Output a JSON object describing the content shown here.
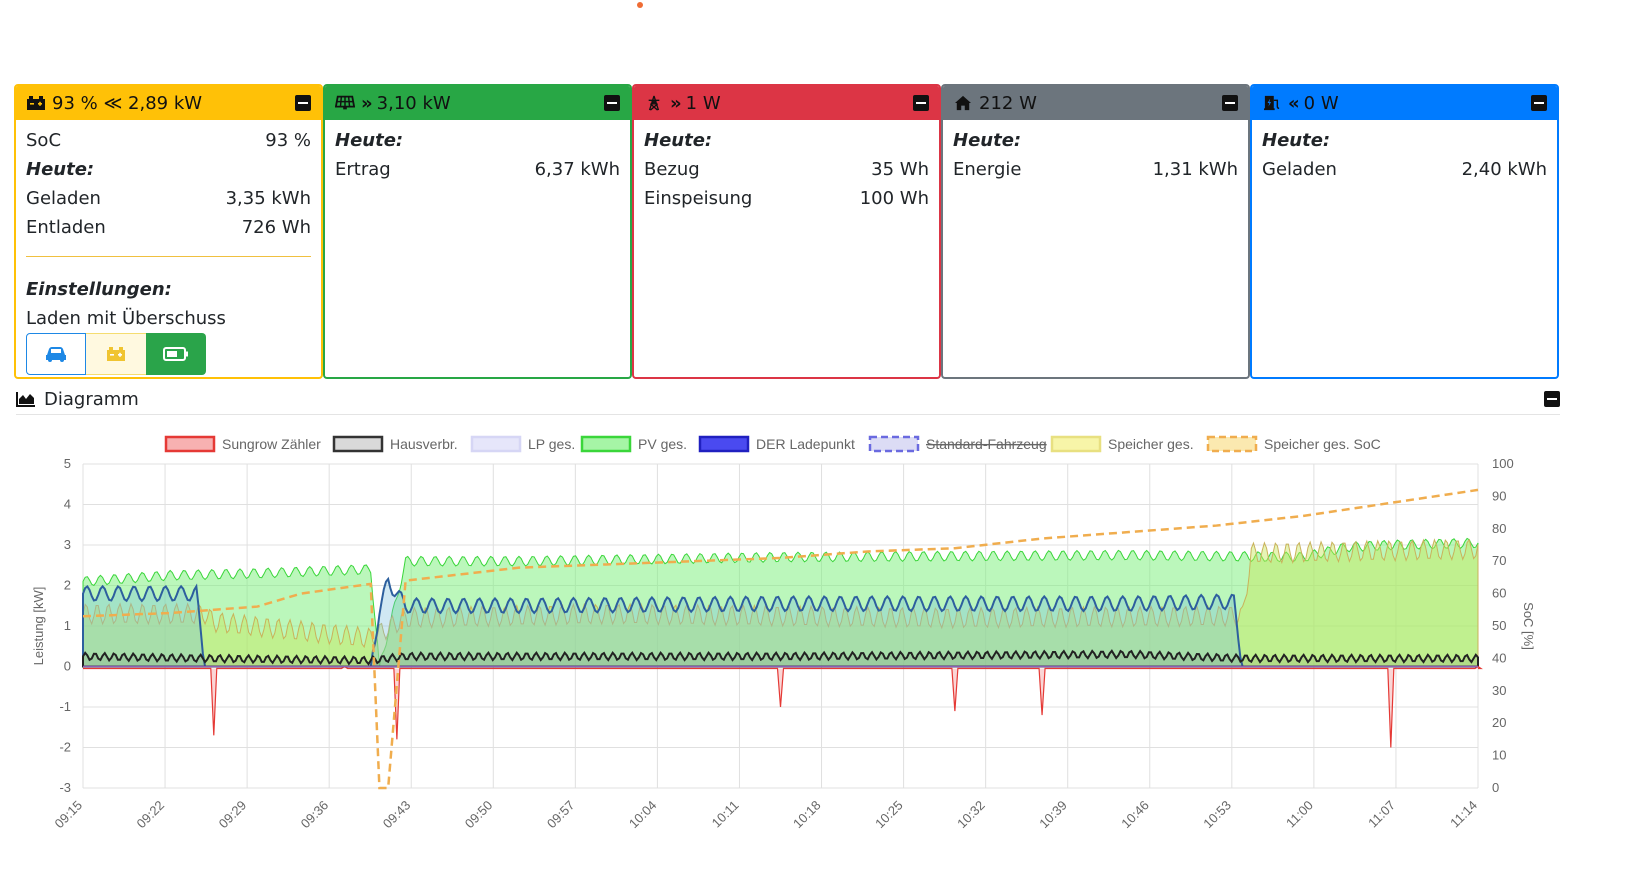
{
  "cards": {
    "battery": {
      "header": "93 % ≪ 2,89 kW",
      "soc_label": "SoC",
      "soc_value": "93 %",
      "heute": "Heute:",
      "geladen_label": "Geladen",
      "geladen_value": "3,35 kWh",
      "entladen_label": "Entladen",
      "entladen_value": "726 Wh",
      "einstellungen": "Einstellungen:",
      "mode": "Laden mit Überschuss",
      "color": "#ffc107"
    },
    "pv": {
      "header": "3,10 kW",
      "heute": "Heute:",
      "ertrag_label": "Ertrag",
      "ertrag_value": "6,37 kWh",
      "color": "#28a745"
    },
    "grid": {
      "header": "1 W",
      "heute": "Heute:",
      "bezug_label": "Bezug",
      "bezug_value": "35 Wh",
      "einspeisung_label": "Einspeisung",
      "einspeisung_value": "100 Wh",
      "color": "#dc3545"
    },
    "house": {
      "header": "212 W",
      "heute": "Heute:",
      "energie_label": "Energie",
      "energie_value": "1,31 kWh",
      "color": "#6c757d"
    },
    "charge": {
      "header": "0 W",
      "heute": "Heute:",
      "geladen_label": "Geladen",
      "geladen_value": "2,40 kWh",
      "color": "#007bff"
    }
  },
  "diagram": {
    "title": "Diagramm"
  },
  "icons": {
    "battery": "car-battery-icon",
    "pv": "solar-panel-icon",
    "grid": "power-tower-icon",
    "house": "home-icon",
    "charge": "charging-station-icon",
    "chart": "area-chart-icon",
    "minimize": "minus-square-icon",
    "car": "car-icon"
  },
  "chart_data": {
    "type": "area",
    "x_ticks": [
      "09:15",
      "09:22",
      "09:29",
      "09:36",
      "09:43",
      "09:50",
      "09:57",
      "10:04",
      "10:11",
      "10:18",
      "10:25",
      "10:32",
      "10:39",
      "10:46",
      "10:53",
      "11:00",
      "11:07",
      "11:14"
    ],
    "ylabel": "Leistung [kW]",
    "ylim": [
      -3,
      5
    ],
    "yticks": [
      5,
      4,
      3,
      2,
      1,
      0,
      -1,
      -2,
      -3
    ],
    "y2label": "SoC [%]",
    "y2lim": [
      0,
      100
    ],
    "y2ticks": [
      100,
      90,
      80,
      70,
      60,
      50,
      40,
      30,
      20,
      10,
      0
    ],
    "legend": [
      {
        "name": "Sungrow Zähler",
        "fill": "#f7b1b1",
        "stroke": "#e53935",
        "dashed": false,
        "struck": false
      },
      {
        "name": "Hausverbr.",
        "fill": "#d9d9d9",
        "stroke": "#333333",
        "dashed": false,
        "struck": false
      },
      {
        "name": "LP ges.",
        "fill": "#e6e6fa",
        "stroke": "#d6d6f5",
        "dashed": false,
        "struck": false
      },
      {
        "name": "PV ges.",
        "fill": "#a6f5a6",
        "stroke": "#3ad63a",
        "dashed": false,
        "struck": false
      },
      {
        "name": "DER Ladepunkt",
        "fill": "#4a4af0",
        "stroke": "#2020c0",
        "dashed": false,
        "struck": false
      },
      {
        "name": "Standard-Fahrzeug",
        "fill": "#dcdcf5",
        "stroke": "#6a6ae0",
        "dashed": true,
        "struck": true
      },
      {
        "name": "Speicher ges.",
        "fill": "#f7f5a8",
        "stroke": "#e8e080",
        "dashed": false,
        "struck": false
      },
      {
        "name": "Speicher ges. SoC",
        "fill": "#fbe9b0",
        "stroke": "#f0ad4e",
        "dashed": true,
        "struck": false
      }
    ],
    "series": [
      {
        "name": "PV ges.",
        "unit": "kW",
        "points": [
          [
            0,
            2.1
          ],
          [
            10,
            2.25
          ],
          [
            20,
            2.3
          ],
          [
            33,
            2.4
          ],
          [
            34,
            0
          ],
          [
            36,
            1.7
          ],
          [
            37,
            2.6
          ],
          [
            50,
            2.6
          ],
          [
            80,
            2.7
          ],
          [
            120,
            2.75
          ],
          [
            140,
            2.7
          ],
          [
            145,
            2.95
          ],
          [
            150,
            3.0
          ],
          [
            160,
            3.05
          ]
        ]
      },
      {
        "name": "DER Ladepunkt",
        "unit": "kW",
        "points": [
          [
            0,
            1.8
          ],
          [
            13,
            1.8
          ],
          [
            14,
            0
          ],
          [
            33,
            0
          ],
          [
            34,
            1.4
          ],
          [
            35,
            2.1
          ],
          [
            37,
            1.5
          ],
          [
            50,
            1.5
          ],
          [
            80,
            1.55
          ],
          [
            120,
            1.55
          ],
          [
            132,
            1.6
          ],
          [
            133,
            0
          ],
          [
            160,
            0
          ]
        ]
      },
      {
        "name": "Speicher ges.",
        "unit": "kW",
        "points": [
          [
            0,
            1.3
          ],
          [
            14,
            1.3
          ],
          [
            15,
            1.1
          ],
          [
            33,
            0.7
          ],
          [
            37,
            1.2
          ],
          [
            60,
            1.3
          ],
          [
            100,
            1.2
          ],
          [
            133,
            1.25
          ],
          [
            134,
            2.8
          ],
          [
            160,
            2.9
          ]
        ]
      },
      {
        "name": "Hausverbr.",
        "unit": "kW",
        "points": [
          [
            0,
            0.25
          ],
          [
            14,
            0.2
          ],
          [
            33,
            0.15
          ],
          [
            37,
            0.25
          ],
          [
            80,
            0.25
          ],
          [
            120,
            0.3
          ],
          [
            133,
            0.2
          ],
          [
            160,
            0.2
          ]
        ]
      },
      {
        "name": "Sungrow Zähler",
        "unit": "kW",
        "points": [
          [
            0,
            -0.05
          ],
          [
            15,
            -1.7
          ],
          [
            30,
            0
          ],
          [
            36,
            -1.8
          ],
          [
            80,
            -1.0
          ],
          [
            100,
            -1.1
          ],
          [
            110,
            -1.2
          ],
          [
            150,
            -2.0
          ],
          [
            160,
            0
          ]
        ]
      },
      {
        "name": "Speicher ges. SoC",
        "unit": "%",
        "points": [
          [
            0,
            53
          ],
          [
            10,
            54
          ],
          [
            20,
            56
          ],
          [
            25,
            60
          ],
          [
            33,
            63
          ],
          [
            34,
            0
          ],
          [
            35,
            0
          ],
          [
            37,
            64
          ],
          [
            50,
            68
          ],
          [
            60,
            69
          ],
          [
            70,
            70
          ],
          [
            80,
            71
          ],
          [
            90,
            73
          ],
          [
            100,
            74
          ],
          [
            110,
            77
          ],
          [
            120,
            79
          ],
          [
            130,
            81
          ],
          [
            140,
            84
          ],
          [
            150,
            88
          ],
          [
            160,
            92
          ]
        ]
      }
    ]
  }
}
